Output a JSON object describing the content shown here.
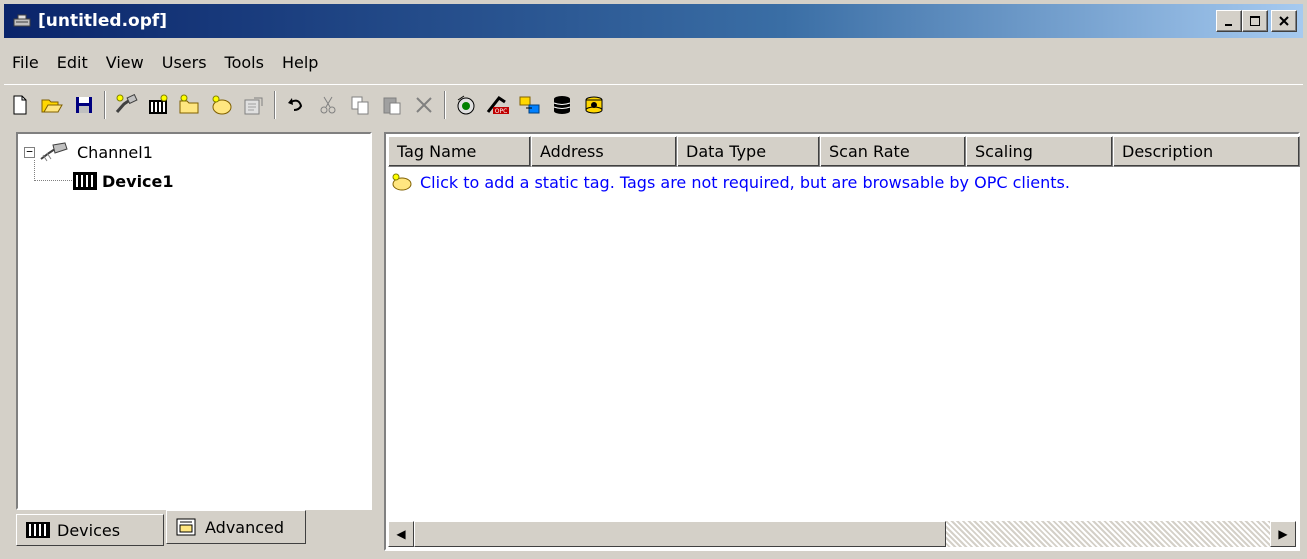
{
  "window": {
    "title": "[untitled.opf]",
    "app_icon": "kepware-server-icon",
    "controls": {
      "minimize": "_",
      "maximize": "□",
      "close": "×"
    }
  },
  "menu": [
    "File",
    "Edit",
    "View",
    "Users",
    "Tools",
    "Help"
  ],
  "toolbar": [
    {
      "icon": "new-file-icon"
    },
    {
      "icon": "open-folder-icon"
    },
    {
      "icon": "save-icon"
    },
    {
      "icon": "new-channel-icon"
    },
    {
      "icon": "new-device-icon"
    },
    {
      "icon": "new-tag-group-icon"
    },
    {
      "icon": "new-tag-icon"
    },
    {
      "icon": "properties-icon",
      "disabled": true
    },
    {
      "icon": "undo-icon"
    },
    {
      "icon": "cut-icon",
      "disabled": true
    },
    {
      "icon": "copy-icon",
      "disabled": true
    },
    {
      "icon": "paste-icon",
      "disabled": true
    },
    {
      "icon": "delete-icon",
      "disabled": true
    },
    {
      "icon": "quick-client-icon"
    },
    {
      "icon": "opc-icon"
    },
    {
      "icon": "data-exchange-icon"
    },
    {
      "icon": "database-icon"
    },
    {
      "icon": "database-alt-icon"
    }
  ],
  "tree": {
    "channel": {
      "label": "Channel1",
      "expander": "−",
      "icon": "channel-icon"
    },
    "device": {
      "label": "Device1",
      "icon": "device-icon"
    }
  },
  "tabs": [
    {
      "label": "Devices",
      "icon": "device-icon"
    },
    {
      "label": "Advanced",
      "icon": "advanced-icon"
    }
  ],
  "table": {
    "columns": [
      "Tag Name",
      "Address",
      "Data Type",
      "Scan Rate",
      "Scaling",
      "Description"
    ],
    "placeholder_row": "Click to add a static tag.  Tags are not required, but are browsable by OPC clients."
  },
  "scrollbar": {
    "left": "◀",
    "right": "▶"
  },
  "colors": {
    "title_start": "#0a246a",
    "title_end": "#a6caf0",
    "link": "#0000ff",
    "chrome": "#d4d0c8"
  }
}
